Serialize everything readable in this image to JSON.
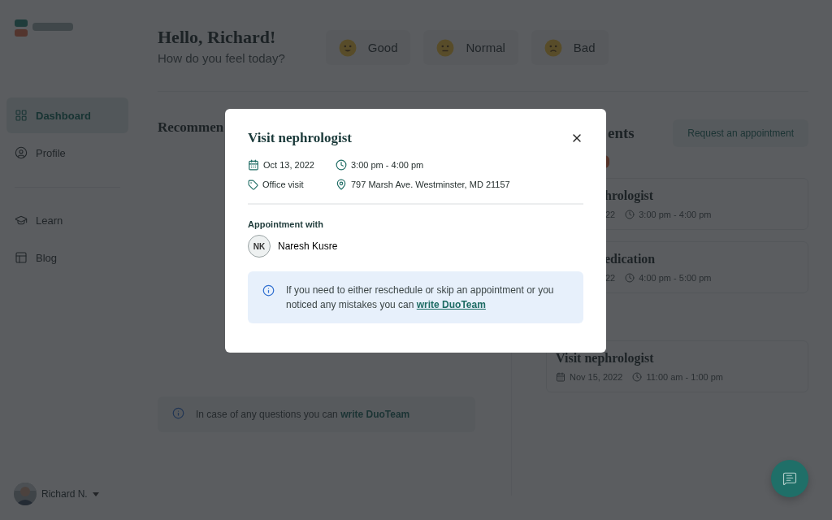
{
  "sidebar": {
    "nav": [
      {
        "label": "Dashboard",
        "selected": true
      },
      {
        "label": "Profile",
        "selected": false
      }
    ],
    "secondary_nav": [
      {
        "label": "Learn",
        "selected": false
      },
      {
        "label": "Blog",
        "selected": false
      }
    ],
    "user": {
      "name": "Richard N."
    }
  },
  "header": {
    "greeting": "Hello, Richard!",
    "subtitle": "How do you feel today?",
    "moods": [
      {
        "label": "Good",
        "kind": "good"
      },
      {
        "label": "Normal",
        "kind": "normal"
      },
      {
        "label": "Bad",
        "kind": "bad"
      }
    ]
  },
  "recommendations": {
    "title": "Recommen",
    "note": {
      "text": "In case of any questions you can ",
      "link": "write DuoTeam"
    }
  },
  "appointments": {
    "title": "ents",
    "request_button": "Request an appointment",
    "cards": [
      {
        "title": "hrologist",
        "date": "22",
        "time": "3:00 pm - 4:00 pm",
        "clipped": true
      },
      {
        "title": "edication",
        "date": "22",
        "time": "4:00 pm - 5:00 pm",
        "clipped": true
      },
      {
        "title": "Visit nephrologist",
        "date": "Nov 15, 2022",
        "time": "11:00 am - 1:00 pm",
        "clipped": false
      }
    ]
  },
  "modal": {
    "title": "Visit nephrologist",
    "date": "Oct 13, 2022",
    "time": "3:00 pm - 4:00 pm",
    "type": "Office visit",
    "address": "797 Marsh Ave. Westminster, MD 21157",
    "with_label": "Appointment with",
    "doctor": {
      "initials": "NK",
      "name": "Naresh Kusre"
    },
    "note": {
      "text": "If you need to either reschedule or skip an appointment or you noticed any mistakes you can ",
      "link": "write DuoTeam"
    }
  }
}
